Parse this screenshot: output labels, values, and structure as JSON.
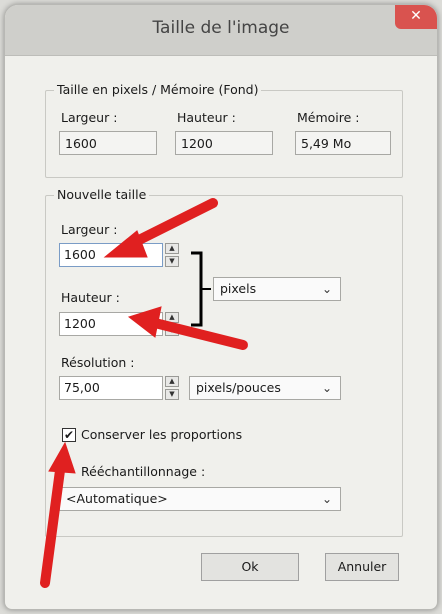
{
  "window": {
    "title": "Taille de l'image",
    "close_glyph": "✕"
  },
  "pixel_memory": {
    "group_label": "Taille en pixels / Mémoire (Fond)",
    "width_label": "Largeur :",
    "width_value": "1600",
    "height_label": "Hauteur :",
    "height_value": "1200",
    "memory_label": "Mémoire :",
    "memory_value": "5,49 Mo"
  },
  "new_size": {
    "group_label": "Nouvelle taille",
    "width_label": "Largeur :",
    "width_value": "1600",
    "height_label": "Hauteur :",
    "height_value": "1200",
    "unit_value": "pixels",
    "resolution_label": "Résolution :",
    "resolution_value": "75,00",
    "resolution_unit": "pixels/pouces",
    "keep_proportions_label": "Conserver les proportions",
    "keep_proportions_checked": true,
    "resample_label": "Rééchantillonnage :",
    "resample_value": "<Automatique>"
  },
  "buttons": {
    "ok_label": "Ok",
    "cancel_label": "Annuler"
  },
  "icons": {
    "spin_up": "▲",
    "spin_down": "▼",
    "chevron": "⌄",
    "check": "✔"
  },
  "colors": {
    "annotation_arrow": "#e02020",
    "accent": "#7a9cc6"
  }
}
